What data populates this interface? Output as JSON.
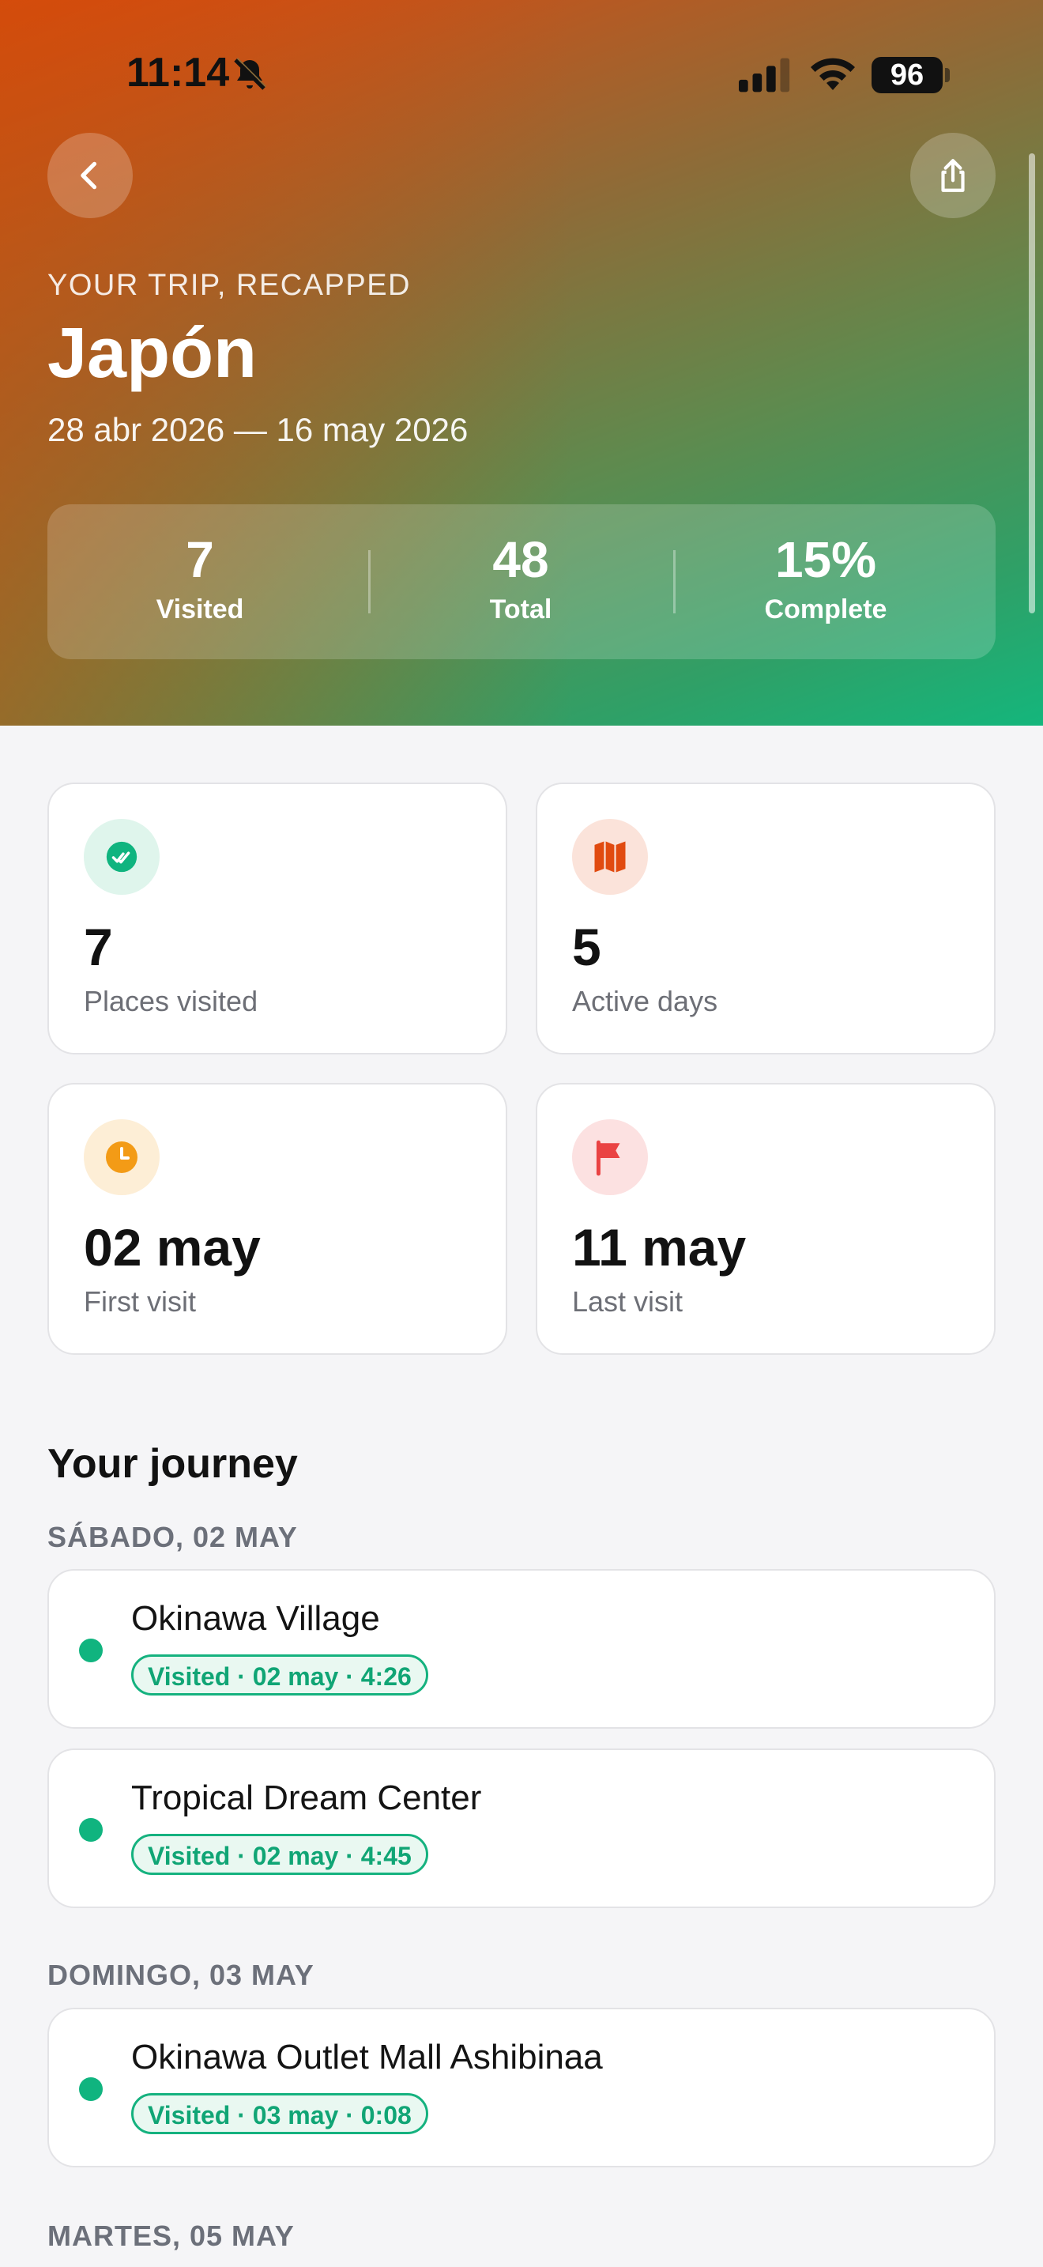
{
  "status_bar": {
    "time": "11:14",
    "battery": "96"
  },
  "header": {
    "eyebrow": "YOUR TRIP, RECAPPED",
    "title": "Japón",
    "dates": "28 abr 2026 — 16 may 2026"
  },
  "summary": [
    {
      "value": "7",
      "label": "Visited"
    },
    {
      "value": "48",
      "label": "Total"
    },
    {
      "value": "15%",
      "label": "Complete"
    }
  ],
  "stats": [
    {
      "value": "7",
      "label": "Places visited",
      "icon": "double-check-icon",
      "color": "#10b47f"
    },
    {
      "value": "5",
      "label": "Active days",
      "icon": "map-icon",
      "color": "#e14b10"
    },
    {
      "value": "02 may",
      "label": "First visit",
      "icon": "clock-icon",
      "color": "#f39b16"
    },
    {
      "value": "11 may",
      "label": "Last visit",
      "icon": "flag-icon",
      "color": "#ea4343"
    }
  ],
  "journey": {
    "title": "Your journey",
    "days": [
      {
        "header": "SÁBADO, 02 MAY",
        "visits": [
          {
            "name": "Okinawa Village",
            "badge": "Visited · 02 may · 4:26"
          },
          {
            "name": "Tropical Dream Center",
            "badge": "Visited · 02 may · 4:45"
          }
        ]
      },
      {
        "header": "DOMINGO, 03 MAY",
        "visits": [
          {
            "name": "Okinawa Outlet Mall Ashibinaa",
            "badge": "Visited · 03 may · 0:08"
          }
        ]
      },
      {
        "header": "MARTES, 05 MAY",
        "visits": []
      }
    ]
  }
}
